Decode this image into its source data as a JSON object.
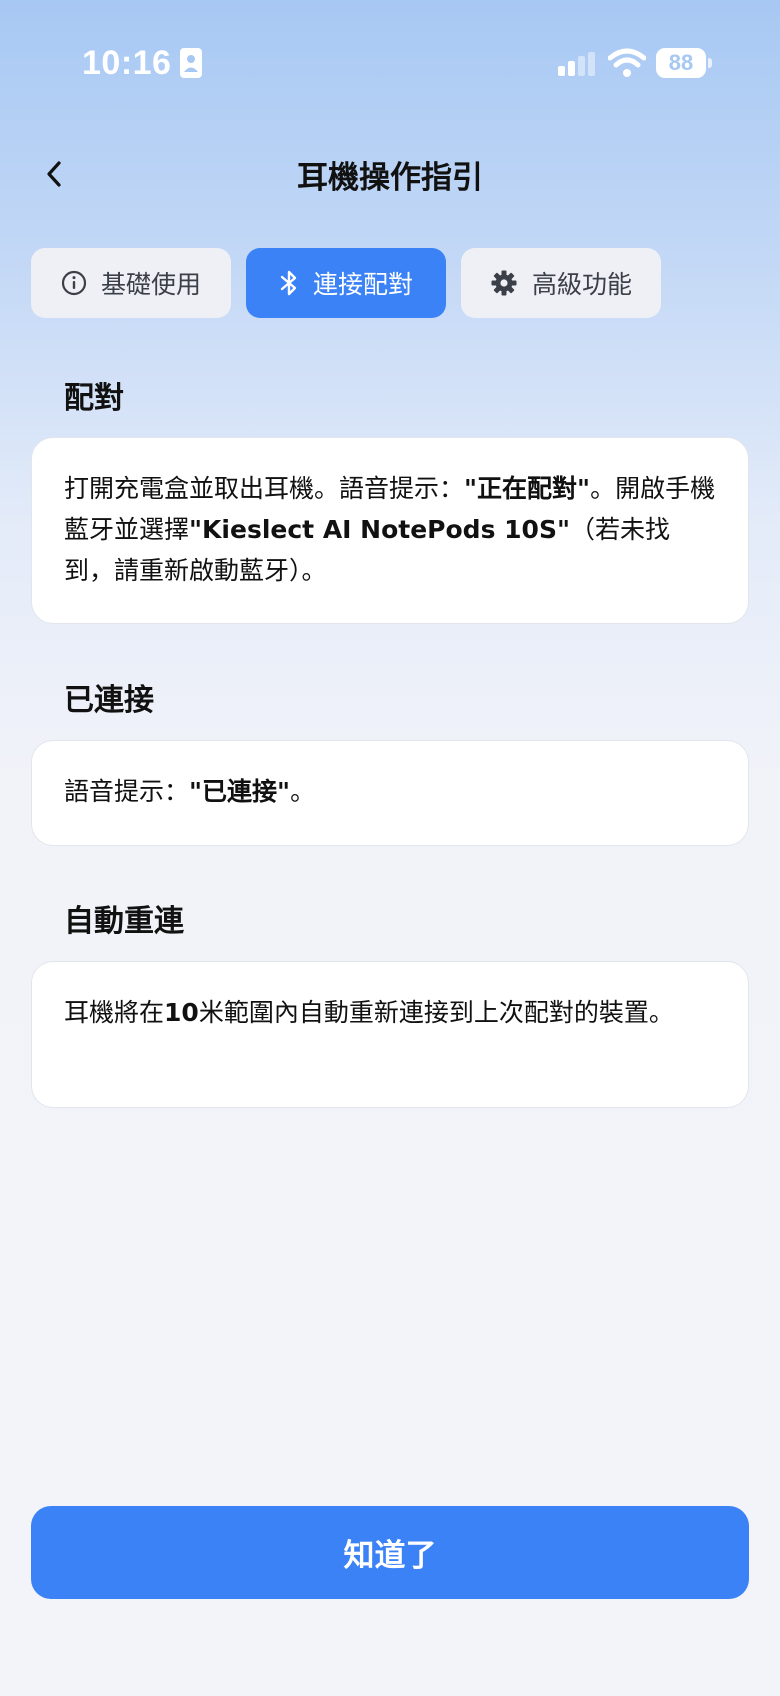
{
  "status_bar": {
    "time": "10:16",
    "battery": "88"
  },
  "header": {
    "title": "耳機操作指引"
  },
  "tabs": [
    {
      "label": "基礎使用",
      "icon": "info-icon",
      "active": false
    },
    {
      "label": "連接配對",
      "icon": "bluetooth-icon",
      "active": true
    },
    {
      "label": "高級功能",
      "icon": "gear-icon",
      "active": false
    }
  ],
  "sections": [
    {
      "title": "配對",
      "parts": [
        "打開充電盒並取出耳機。語音提示：",
        "\"正在配對\"",
        "。開啟手機藍牙並選擇",
        "\"Kieslect AI NotePods 10S\"",
        "（若未找到，請重新啟動藍牙）。"
      ]
    },
    {
      "title": "已連接",
      "parts": [
        "語音提示：",
        "\"已連接\"",
        "。"
      ]
    },
    {
      "title": "自動重連",
      "parts": [
        "耳機將在",
        "10",
        "米範圍內自動重新連接到上次配對的裝置。"
      ]
    }
  ],
  "button": {
    "label": "知道了"
  },
  "colors": {
    "accent": "#3b82f6",
    "tab_inactive": "#eef0f5",
    "card_bg": "#ffffff"
  }
}
